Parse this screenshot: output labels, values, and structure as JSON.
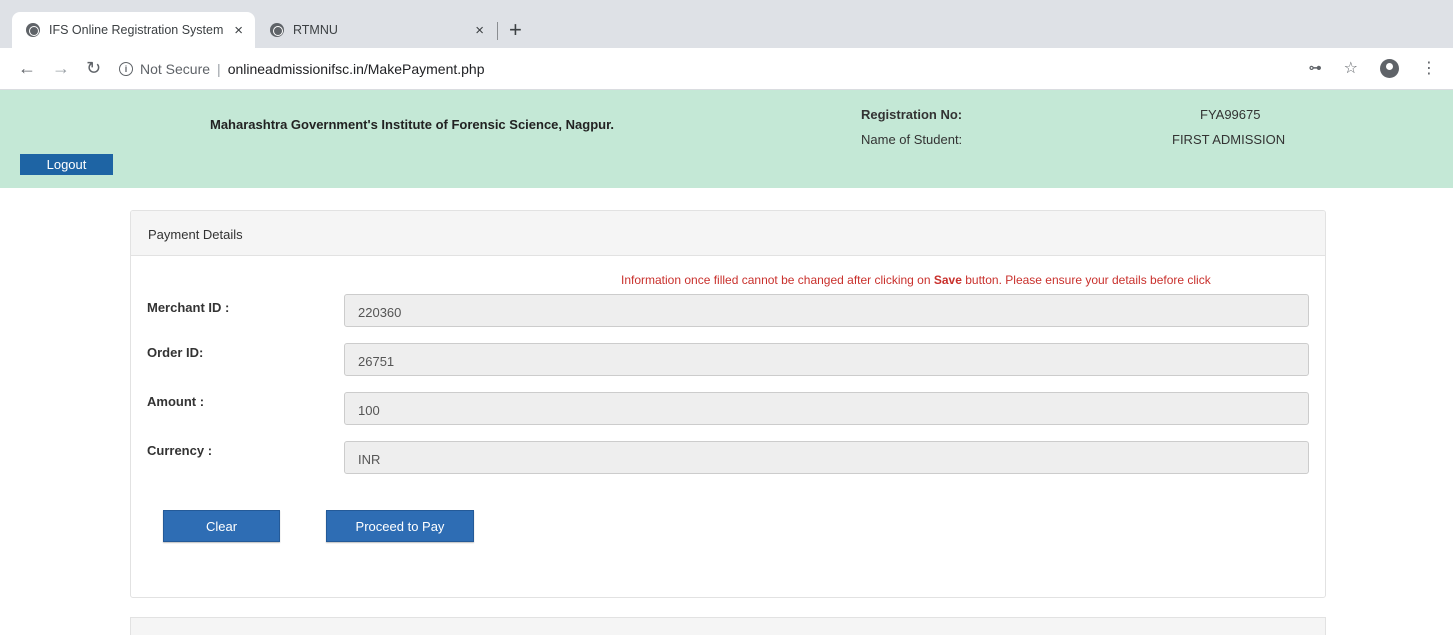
{
  "browser": {
    "tabs": [
      {
        "title": "IFS Online Registration System",
        "active": true
      },
      {
        "title": "RTMNU",
        "active": false
      }
    ],
    "new_tab_label": "+",
    "close_glyph": "×",
    "security_label": "Not Secure",
    "url": "onlineadmissionifsc.in/MakePayment.php"
  },
  "header": {
    "institute": "Maharashtra Government's Institute of Forensic Science, Nagpur.",
    "registration_label": "Registration No:",
    "registration_value": "FYA99675",
    "student_label": "Name of Student:",
    "student_value": "FIRST ADMISSION",
    "logout_label": "Logout"
  },
  "panel": {
    "heading": "Payment Details",
    "notice_pre": "Information once filled cannot be changed after clicking on ",
    "notice_bold": "Save",
    "notice_post": " button. Please ensure your details before click",
    "fields": [
      {
        "label": "Merchant ID :",
        "value": "220360"
      },
      {
        "label": "Order ID:",
        "value": "26751"
      },
      {
        "label": "Amount :",
        "value": "100"
      },
      {
        "label": "Currency :",
        "value": "INR"
      }
    ],
    "clear_label": "Clear",
    "pay_label": "Proceed to Pay"
  },
  "colors": {
    "header_bg": "#c4e8d6",
    "button_blue": "#2e6db4",
    "notice_red": "#c9302c"
  }
}
